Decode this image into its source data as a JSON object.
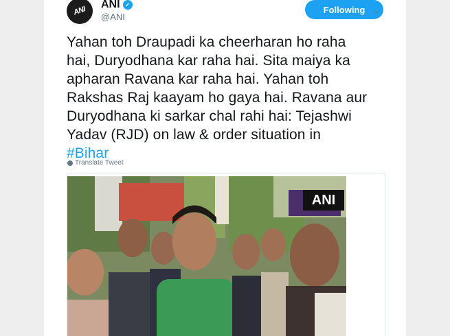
{
  "account": {
    "name": "ANI",
    "handle": "@ANI",
    "avatar_text": "ANI",
    "verified": true
  },
  "follow_button": {
    "label": "Following"
  },
  "menu": {
    "icon": "chevron-down-icon"
  },
  "tweet": {
    "lines": [
      "Yahan toh Draupadi ka cheerharan ho raha",
      "hai, Duryodhana kar raha hai. Sita maiya ka",
      "apharan Ravana kar raha hai. Yahan toh",
      "Rakshas Raj kaayam ho gaya hai. Ravana aur",
      "Duryodhana ki sarkar chal rahi hai: Tejashwi",
      "Yadav (RJD) on law & order situation in"
    ],
    "hashtag": "#Bihar"
  },
  "translate": {
    "label": "Translate Tweet"
  },
  "media": {
    "watermark": "ANI"
  },
  "colors": {
    "accent": "#1da1f2",
    "text": "#14171a",
    "muted": "#657786",
    "background": "#eeeeee"
  }
}
